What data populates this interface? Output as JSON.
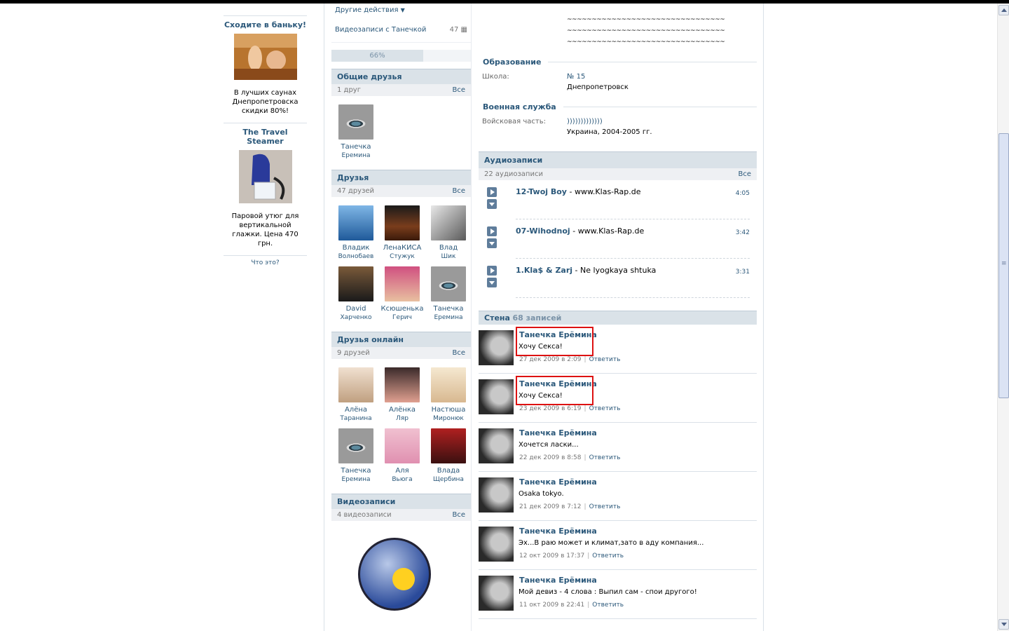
{
  "ads": [
    {
      "title": "Сходите в баньку!",
      "text": "В лучших саунах Днепропетровска скидки 80%!"
    },
    {
      "title": "The Travel Steamer",
      "text": "Паровой утюг для вертикальной глажки. Цена 470 грн."
    }
  ],
  "ads_what": "Что это?",
  "actions": {
    "other_actions": "Другие действия",
    "videos_with": "Видеозаписи с Танечкой",
    "videos_with_count": "47"
  },
  "profile_progress": {
    "label": "66%",
    "value": 0.66
  },
  "common_friends": {
    "title": "Общие друзья",
    "count": "1 друг",
    "all": "Все",
    "items": [
      {
        "first": "Танечка",
        "last": "Еремина"
      }
    ]
  },
  "friends": {
    "title": "Друзья",
    "count": "47 друзей",
    "all": "Все",
    "items": [
      {
        "first": "Владик",
        "last": "Волнобаев"
      },
      {
        "first": "ЛенаКИСА",
        "last": "Стужук"
      },
      {
        "first": "Влад",
        "last": "Шик"
      },
      {
        "first": "David",
        "last": "Харченко"
      },
      {
        "first": "Ксюшенька",
        "last": "Герич"
      },
      {
        "first": "Танечка",
        "last": "Еремина"
      }
    ]
  },
  "friends_online": {
    "title": "Друзья онлайн",
    "count": "9 друзей",
    "all": "Все",
    "items": [
      {
        "first": "Алёна",
        "last": "Таранина"
      },
      {
        "first": "Алёнка",
        "last": "Ляр"
      },
      {
        "first": "Настюша",
        "last": "Миронюк"
      },
      {
        "first": "Танечка",
        "last": "Еремина"
      },
      {
        "first": "Аля",
        "last": "Вьюга"
      },
      {
        "first": "Влада",
        "last": "Щербина"
      }
    ]
  },
  "videos": {
    "title": "Видеозаписи",
    "count": "4 видеозаписи",
    "all": "Все"
  },
  "tildes": [
    "~~~~~~~~~~~~~~~~~~~~~~~~~~~~~~~~",
    "~~~~~~~~~~~~~~~~~~~~~~~~~~~~~~~~",
    "~~~~~~~~~~~~~~~~~~~~~~~~~~~~~~~~"
  ],
  "education": {
    "title": "Образование",
    "school_label": "Школа:",
    "school_value": "№ 15",
    "school_city": "Днепропетровск"
  },
  "military": {
    "title": "Военная служба",
    "unit_label": "Войсковая часть:",
    "unit_value": ")))))))))))))",
    "unit_detail": "Украина, 2004-2005 гг."
  },
  "audio": {
    "title": "Аудиозаписи",
    "count": "22 аудиозаписи",
    "all": "Все",
    "tracks": [
      {
        "artist": "12-Twoj Boy",
        "title": "www.Klas-Rap.de",
        "duration": "4:05"
      },
      {
        "artist": "07-Wihodnoj",
        "title": "www.Klas-Rap.de",
        "duration": "3:42"
      },
      {
        "artist": "1.Kla$ & Zarj",
        "title": "Ne lyogkaya shtuka",
        "duration": "3:31"
      }
    ]
  },
  "wall": {
    "title": "Стена",
    "count": "68 записей",
    "reply_label": "Ответить",
    "posts": [
      {
        "author": "Танечка Ерёмина",
        "text": "Хочу Секса!",
        "date": "27 дек 2009 в 2:09"
      },
      {
        "author": "Танечка Ерёмина",
        "text": "Хочу Секса!",
        "date": "23 дек 2009 в 6:19"
      },
      {
        "author": "Танечка Ерёмина",
        "text": "Хочется ласки...",
        "date": "22 дек 2009 в 8:58"
      },
      {
        "author": "Танечка Ерёмина",
        "text": "Osaka tokyo.",
        "date": "21 дек 2009 в 7:12"
      },
      {
        "author": "Танечка Ерёмина",
        "text": "Эх...В раю может и климат,зато в аду компания...",
        "date": "12 окт 2009 в 17:37"
      },
      {
        "author": "Танечка Ерёмина",
        "text": "Мой девиз - 4 слова : Выпил сам - спои другого!",
        "date": "11 окт 2009 в 22:41"
      }
    ]
  }
}
